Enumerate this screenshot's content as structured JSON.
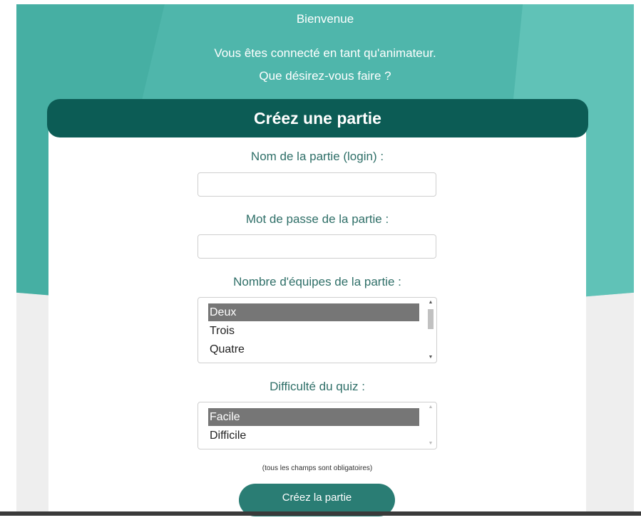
{
  "welcome": {
    "title": "Bienvenue",
    "line1": "Vous êtes connecté en tant qu'animateur.",
    "line2": "Que désirez-vous faire ?"
  },
  "form": {
    "header": "Créez une partie",
    "name_label": "Nom de la partie (login) :",
    "name_value": "",
    "password_label": "Mot de passe de la partie :",
    "password_value": "",
    "teams_label": "Nombre d'équipes de la partie :",
    "teams_options": [
      "Deux",
      "Trois",
      "Quatre"
    ],
    "teams_selected": "Deux",
    "difficulty_label": "Difficulté du quiz :",
    "difficulty_options": [
      "Facile",
      "Difficile"
    ],
    "difficulty_selected": "Facile",
    "required_note": "(tous les champs sont obligatoires)",
    "submit_label": "Créez la partie"
  },
  "colors": {
    "hero": "#4fb6ab",
    "header": "#0c5c55",
    "button": "#2a7d74",
    "label": "#2f6f68",
    "selection": "#767676"
  }
}
